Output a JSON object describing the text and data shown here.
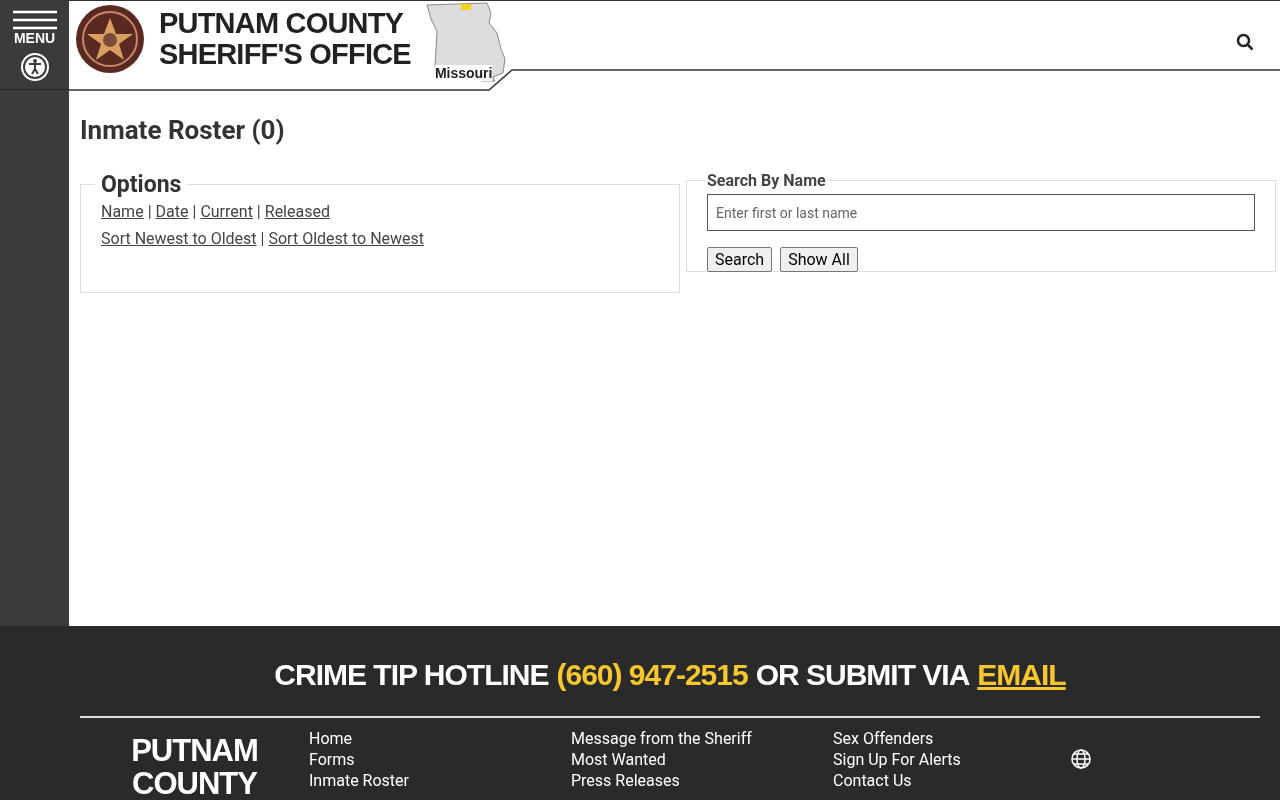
{
  "header": {
    "menu_label": "MENU",
    "title_lines": [
      "PUTNAM COUNTY",
      "SHERIFF'S OFFICE"
    ],
    "map_label": "Missouri"
  },
  "page_title": "Inmate Roster (0)",
  "options": {
    "legend": "Options",
    "separator": "|",
    "link_lines": [
      {
        "links": [
          "Name",
          "Date",
          "Current",
          "Released"
        ]
      },
      {
        "links": [
          "Sort Newest to Oldest",
          "Sort Oldest to Newest"
        ]
      }
    ]
  },
  "search": {
    "legend": "Search By Name",
    "placeholder": "Enter first or last name",
    "buttons": [
      "Search",
      "Show All"
    ]
  },
  "footer": {
    "hotline": [
      {
        "kind": "text",
        "text": "CRIME TIP HOTLINE"
      },
      {
        "kind": "highlight",
        "text": "(660) 947-2515"
      },
      {
        "kind": "text",
        "text": "OR SUBMIT VIA"
      },
      {
        "kind": "link",
        "text": "EMAIL"
      }
    ],
    "brand_lines": [
      "PUTNAM",
      "COUNTY"
    ],
    "columns": [
      [
        "Home",
        "Forms",
        "Inmate Roster"
      ],
      [
        "Message from the Sheriff",
        "Most Wanted",
        "Press Releases"
      ],
      [
        "Sex Offenders",
        "Sign Up For Alerts",
        "Contact Us"
      ]
    ]
  }
}
